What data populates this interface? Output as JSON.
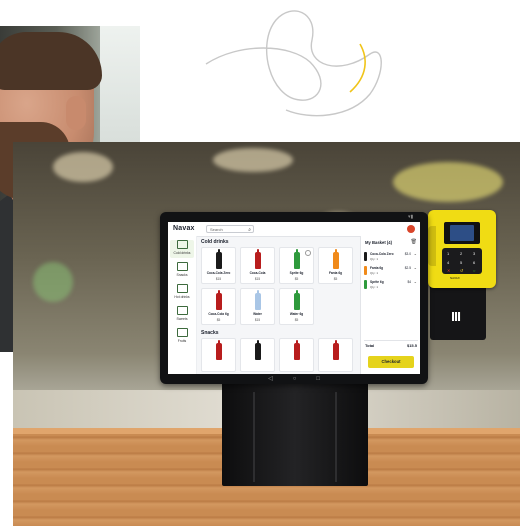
{
  "app": {
    "logo": "Navax",
    "search_placeholder": "Search",
    "sidebar": [
      {
        "label": "Cold drinks",
        "icon": "bottle-icon"
      },
      {
        "label": "Snacks",
        "icon": "snack-icon"
      },
      {
        "label": "Hot drinks",
        "icon": "cup-icon"
      },
      {
        "label": "Sweets",
        "icon": "candy-icon"
      },
      {
        "label": "Fruits",
        "icon": "fruit-icon"
      }
    ],
    "sections": [
      {
        "title": "Cold drinks",
        "products": [
          {
            "name": "Coca-Cola Zero",
            "price": "$15",
            "color": "#1a1a1a"
          },
          {
            "name": "Coca-Cola",
            "price": "$15",
            "color": "#b81d1d"
          },
          {
            "name": "Sprite 6g",
            "price": "$5",
            "color": "#2e9a3c"
          },
          {
            "name": "Fanta 6g",
            "price": "$5",
            "color": "#f08a1a"
          },
          {
            "name": "Coca-Cola 6g",
            "price": "$5",
            "color": "#b81d1d"
          },
          {
            "name": "Water",
            "price": "$15",
            "color": "#a9c6e6"
          },
          {
            "name": "Water 6g",
            "price": "$5",
            "color": "#2e9a3c"
          }
        ]
      },
      {
        "title": "Snacks"
      }
    ],
    "basket": {
      "title": "My Basket (4)",
      "items": [
        {
          "name": "Coca-Cola Zero",
          "qty": "Qty: 1",
          "price": "$3.0",
          "color": "#1a1a1a"
        },
        {
          "name": "Fanta 6g",
          "qty": "Qty: 1",
          "price": "$2.5",
          "color": "#f08a1a"
        },
        {
          "name": "Sprite 6g",
          "qty": "Qty: 1",
          "price": "$4",
          "color": "#2e9a3c"
        }
      ],
      "total_label": "Total",
      "total_value": "$15.5",
      "checkout_label": "Checkout"
    },
    "reader_label": "NAVAX"
  },
  "colors": {
    "accent": "#e5d31c",
    "reader_body": "#f0dc14",
    "doodle_line": "#c8c8c8",
    "doodle_accent": "#f0c419"
  }
}
